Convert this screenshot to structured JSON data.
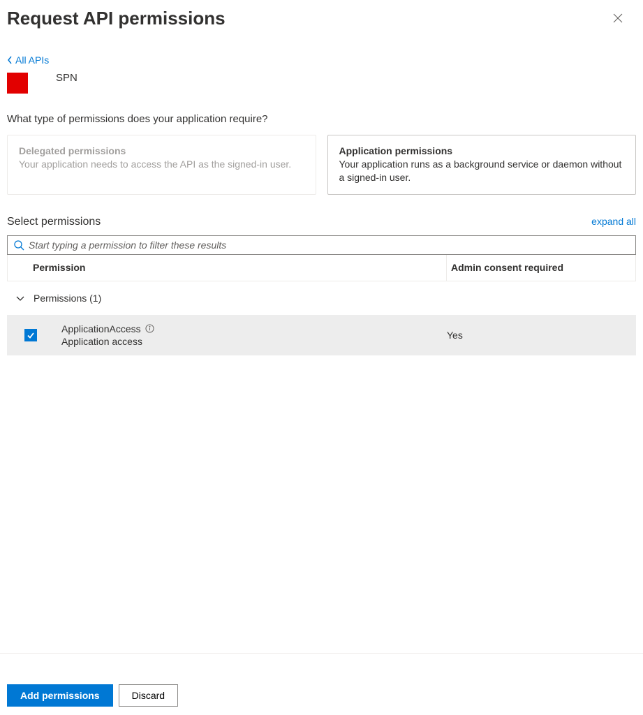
{
  "header": {
    "title": "Request API permissions"
  },
  "back": {
    "label": "All APIs"
  },
  "app": {
    "name": "SPN"
  },
  "question": "What type of permissions does your application require?",
  "cards": {
    "delegated": {
      "title": "Delegated permissions",
      "desc": "Your application needs to access the API as the signed-in user."
    },
    "application": {
      "title": "Application permissions",
      "desc": "Your application runs as a background service or daemon without a signed-in user."
    }
  },
  "select": {
    "title": "Select permissions",
    "expand": "expand all",
    "search_placeholder": "Start typing a permission to filter these results"
  },
  "table": {
    "col_permission": "Permission",
    "col_admin": "Admin consent required"
  },
  "group": {
    "label": "Permissions (1)"
  },
  "permissions": [
    {
      "name": "ApplicationAccess",
      "desc": "Application access",
      "admin": "Yes",
      "checked": true
    }
  ],
  "footer": {
    "add": "Add permissions",
    "discard": "Discard"
  }
}
